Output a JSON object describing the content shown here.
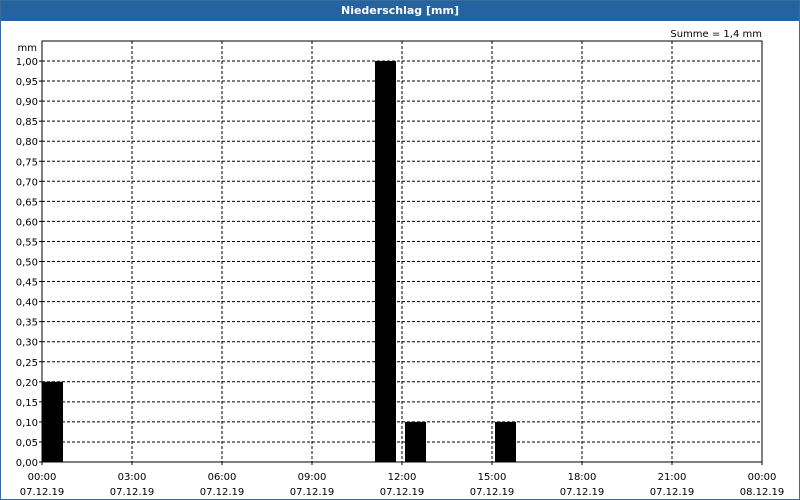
{
  "title": "Niederschlag [mm]",
  "chart_data": {
    "type": "bar",
    "title": "Niederschlag [mm]",
    "ylabel": "mm",
    "ylim": [
      0,
      1.0
    ],
    "y_ticks": [
      "0,00",
      "0,05",
      "0,10",
      "0,15",
      "0,20",
      "0,25",
      "0,30",
      "0,35",
      "0,40",
      "0,45",
      "0,50",
      "0,55",
      "0,60",
      "0,65",
      "0,70",
      "0,75",
      "0,80",
      "0,85",
      "0,90",
      "0,95",
      "1,00"
    ],
    "x_range_hours": [
      0,
      24
    ],
    "x_ticks": [
      {
        "time": "00:00",
        "date": "07.12.19"
      },
      {
        "time": "03:00",
        "date": "07.12.19"
      },
      {
        "time": "06:00",
        "date": "07.12.19"
      },
      {
        "time": "09:00",
        "date": "07.12.19"
      },
      {
        "time": "12:00",
        "date": "07.12.19"
      },
      {
        "time": "15:00",
        "date": "07.12.19"
      },
      {
        "time": "18:00",
        "date": "07.12.19"
      },
      {
        "time": "21:00",
        "date": "07.12.19"
      },
      {
        "time": "00:00",
        "date": "08.12.19"
      }
    ],
    "bars": [
      {
        "start_hour": 0,
        "end_hour": 0.7,
        "value": 0.2
      },
      {
        "start_hour": 11.1,
        "end_hour": 11.8,
        "value": 1.0
      },
      {
        "start_hour": 12.1,
        "end_hour": 12.8,
        "value": 0.1
      },
      {
        "start_hour": 15.1,
        "end_hour": 15.8,
        "value": 0.1
      }
    ],
    "summary": "Summe = 1,4 mm",
    "grid": true,
    "colors": {
      "bar": "#000000",
      "title_bar": "#2563a0",
      "grid": "#000000"
    }
  }
}
